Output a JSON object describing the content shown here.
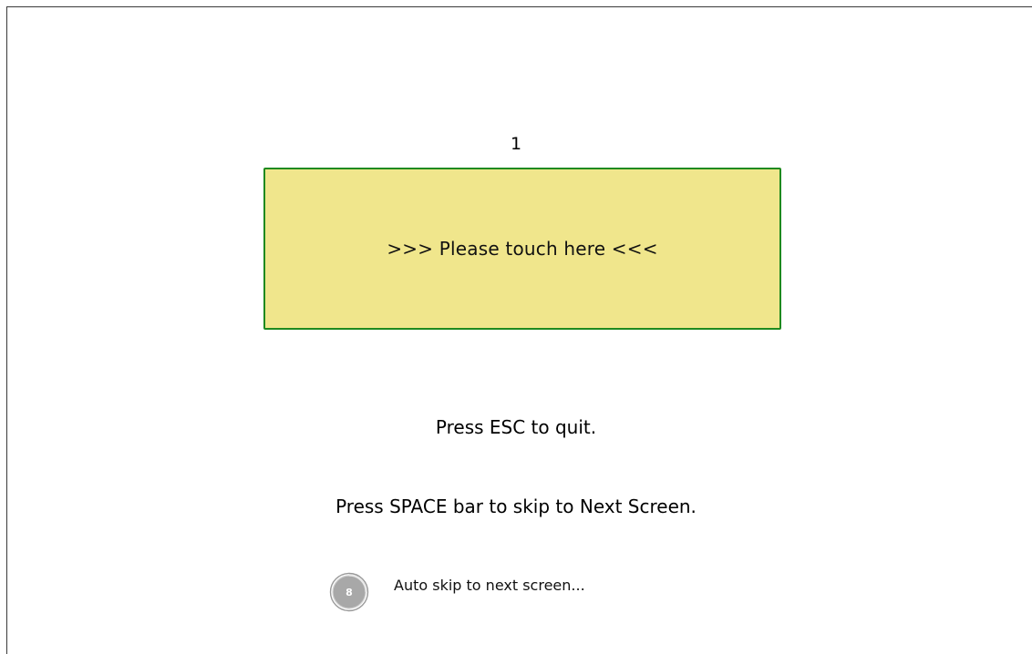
{
  "screen": {
    "number": "1"
  },
  "touch_target": {
    "label": ">>> Please touch here <<<",
    "background_color": "#f0e68c",
    "border_color": "#1f8a1f"
  },
  "instructions": {
    "esc": "Press ESC to quit.",
    "space": "Press SPACE bar to skip to Next Screen."
  },
  "auto_skip": {
    "countdown": "8",
    "label": "Auto skip to next screen...",
    "countdown_icon": "circular-timer-icon"
  }
}
